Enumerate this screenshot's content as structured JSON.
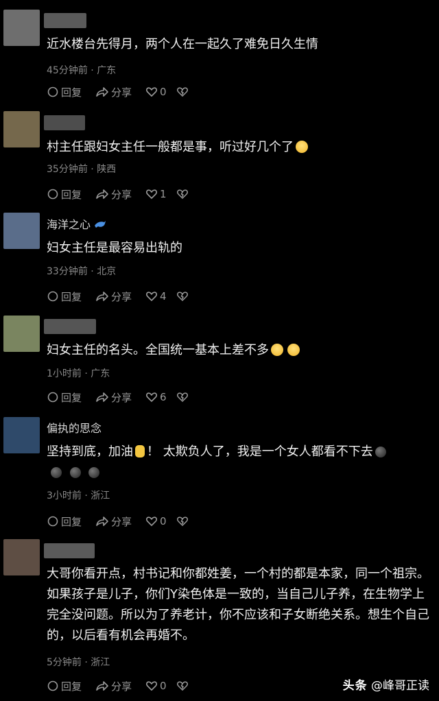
{
  "comments": [
    {
      "username": "",
      "avatar_color": "#6e6e6e",
      "name_blur_color": "#5a5a5a",
      "body": "近水楼台先得月，两个人在一起久了难免日久生情",
      "emojis": [],
      "time": "45分钟前",
      "location": "广东",
      "reply_label": "回复",
      "share_label": "分享",
      "likes": "0"
    },
    {
      "username": "",
      "avatar_color": "#75684c",
      "name_blur_color": "#4d4d4d",
      "body": "村主任跟妇女主任一般都是事，听过好几个了",
      "emojis": [
        "laugh"
      ],
      "time": "35分钟前",
      "location": "陕西",
      "reply_label": "回复",
      "share_label": "分享",
      "likes": "1"
    },
    {
      "username": "海洋之心",
      "avatar_color": "#5a6d8a",
      "body": "妇女主任是最容易出轨的",
      "emojis": [],
      "time": "33分钟前",
      "location": "北京",
      "reply_label": "回复",
      "share_label": "分享",
      "likes": "4"
    },
    {
      "username": "",
      "avatar_color": "#7a8560",
      "name_blur_color": "#555555",
      "body": "妇女主任的名头。全国统一基本上差不多",
      "emojis": [
        "laugh",
        "laugh"
      ],
      "time": "1小时前",
      "location": "广东",
      "reply_label": "回复",
      "share_label": "分享",
      "likes": "6"
    },
    {
      "username": "偏执的思念",
      "avatar_color": "#2f4a6a",
      "body_part1": "坚持到底，加油",
      "body_part2": "！ 太欺负人了，我是一个女人都看不下去",
      "time": "3小时前",
      "location": "浙江",
      "reply_label": "回复",
      "share_label": "分享",
      "likes": "0"
    },
    {
      "username": "",
      "avatar_color": "#5e4e44",
      "name_blur_color": "#5a5a5a",
      "body": "大哥你看开点，村书记和你都姓姜，一个村的都是本家，同一个祖宗。如果孩子是儿子，你们Y染色体是一致的，当自己儿子养，在生物学上完全没问题。所以为了养老计，你不应该和子女断绝关系。想生个自己的，以后看有机会再婚不。",
      "time": "5分钟前",
      "location": "浙江",
      "reply_label": "回复",
      "share_label": "分享",
      "likes": "0"
    }
  ],
  "meta_separator": "·",
  "watermark": {
    "brand": "头条",
    "author": "@峰哥正读"
  }
}
